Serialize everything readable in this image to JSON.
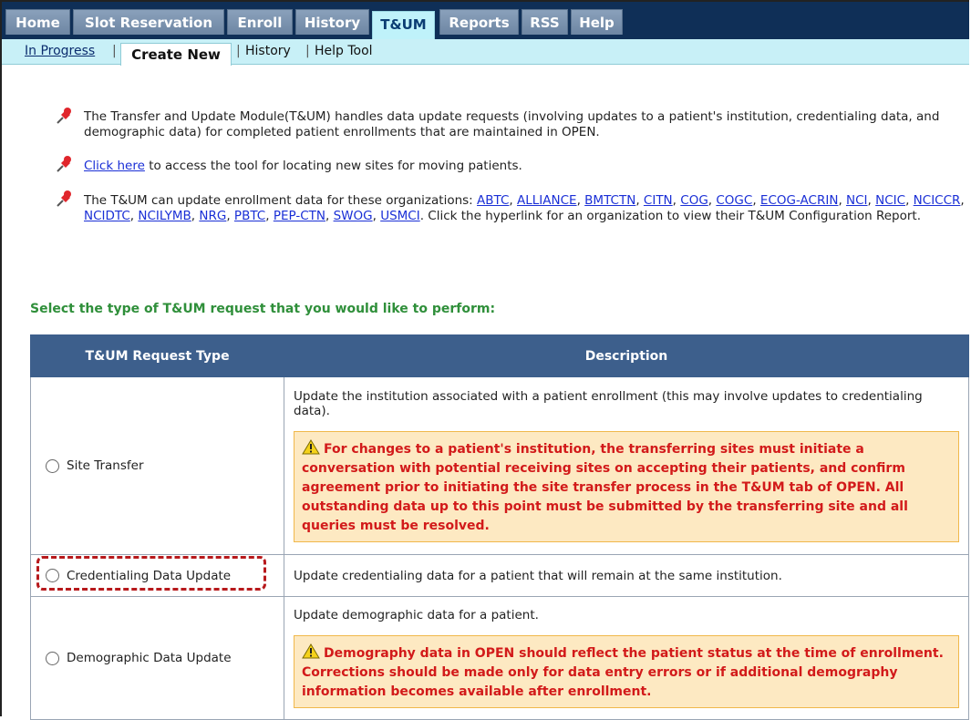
{
  "nav": {
    "tabs": [
      "Home",
      "Slot Reservation",
      "Enroll",
      "History",
      "T&UM",
      "Reports",
      "RSS",
      "Help"
    ],
    "active_tab": "T&UM"
  },
  "subnav": {
    "in_progress": "In Progress",
    "create_new": "Create New",
    "history": "History",
    "help_tool": "Help Tool",
    "separator": "|"
  },
  "info": {
    "p1": "The Transfer and Update Module(T&UM) handles data update requests (involving updates to a patient's institution, credentialing data, and demographic data) for completed patient enrollments that are maintained in OPEN.",
    "p2_link": "Click here",
    "p2_text": "to access the tool for locating new sites for moving patients.",
    "p3_prefix": "The T&UM can update enrollment data for these organizations:",
    "orgs": [
      "ABTC",
      "ALLIANCE",
      "BMTCTN",
      "CITN",
      "COG",
      "COGC",
      "ECOG-ACRIN",
      "NCI",
      "NCIC",
      "NCICCR",
      "NCIDTC",
      "NCILYMB",
      "NRG",
      "PBTC",
      "PEP-CTN",
      "SWOG",
      "USMCI"
    ],
    "p3_suffix": "Click the hyperlink for an organization to view their T&UM Configuration Report."
  },
  "prompt": "Select the type of T&UM request that you would like to perform:",
  "table": {
    "col_type": "T&UM Request Type",
    "col_desc": "Description",
    "rows": [
      {
        "type": "Site Transfer",
        "desc": "Update the institution associated with a patient enrollment (this may involve updates to credentialing data).",
        "warning": "For changes to a patient's institution, the transferring sites must initiate a conversation with potential receiving sites on accepting their patients, and confirm agreement prior to initiating the site transfer process in the T&UM tab of OPEN. All outstanding data up to this point must be submitted by the transferring site and all queries must be resolved."
      },
      {
        "type": "Credentialing Data Update",
        "desc": "Update credentialing data for a patient that will remain at the same institution."
      },
      {
        "type": "Demographic Data Update",
        "desc": "Update demographic data for a patient.",
        "warning": "Demography data in OPEN should reflect the patient status at the time of enrollment. Corrections should be made only for data entry errors or if additional demography information becomes available after enrollment."
      }
    ]
  },
  "colors": {
    "nav_bg": "#0f2f57",
    "subnav_bg": "#c8f0f7",
    "table_header": "#3d5f8c",
    "prompt_green": "#2f8f3a",
    "warning_text": "#d21a1a",
    "warning_bg": "#fde9c2",
    "highlight_dash": "#b7191c"
  }
}
